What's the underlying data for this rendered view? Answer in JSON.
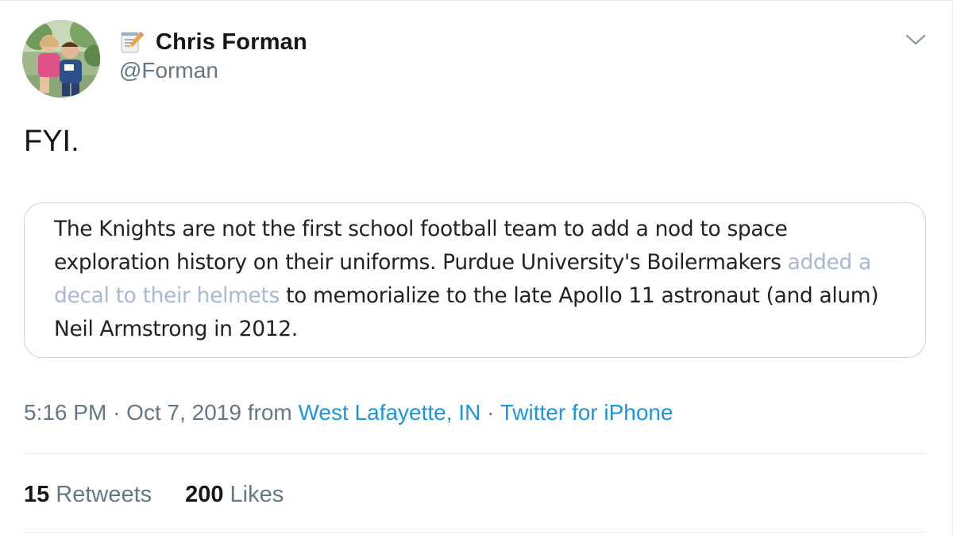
{
  "tweet": {
    "display_name": "Chris Forman",
    "name_emoji_icon": "memo-pencil-icon",
    "handle": "@Forman",
    "text": "FYI.",
    "quote": {
      "text_before": "The Knights are not the first school football team to add a nod to space exploration history on their uniforms. Purdue University's Boilermakers ",
      "link_text": "added a decal to their helmets",
      "text_after": " to memorialize to the late Apollo 11 astronaut (and alum) Neil Armstrong in 2012."
    },
    "meta": {
      "time": "5:16 PM",
      "separator": "·",
      "date": "Oct 7, 2019",
      "from_label": "from",
      "location": "West Lafayette, IN",
      "client": "Twitter for iPhone"
    },
    "stats": {
      "retweets_count": "15",
      "retweets_label": "Retweets",
      "likes_count": "200",
      "likes_label": "Likes"
    }
  },
  "colors": {
    "name": "#14171a",
    "secondary": "#657786",
    "link": "#1b95e0",
    "quote_link": "#a8b8d8",
    "border": "#ccd6dd",
    "divider": "#e6ecf0"
  }
}
